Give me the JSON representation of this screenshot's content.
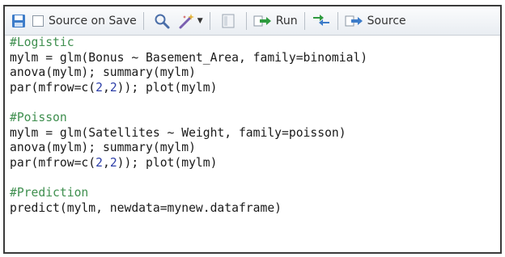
{
  "toolbar": {
    "source_on_save_label": "Source on Save",
    "run_label": "Run",
    "source_label": "Source"
  },
  "icons": [
    "save-icon",
    "checkbox",
    "search-icon",
    "code-tools-wand-icon",
    "compile-report-icon",
    "run-arrow-icon",
    "rerun-icon",
    "source-arrow-icon"
  ],
  "colors": {
    "comment": "#3f8f4f",
    "number": "#2d3fa8",
    "text": "#1a1a1a"
  },
  "code": {
    "l1": "#Logistic",
    "l2": "mylm = glm(Bonus ~ Basement_Area, family=binomial)",
    "l3": "anova(mylm); summary(mylm)",
    "l4a": "par(mfrow=c(",
    "l4n1": "2",
    "l4c": ",",
    "l4n2": "2",
    "l4b": ")); plot(mylm)",
    "l6": "#Poisson",
    "l7": "mylm = glm(Satellites ~ Weight, family=poisson)",
    "l8": "anova(mylm); summary(mylm)",
    "l9a": "par(mfrow=c(",
    "l9n1": "2",
    "l9c": ",",
    "l9n2": "2",
    "l9b": ")); plot(mylm)",
    "l11": "#Prediction",
    "l12": "predict(mylm, newdata=mynew.dataframe)"
  }
}
